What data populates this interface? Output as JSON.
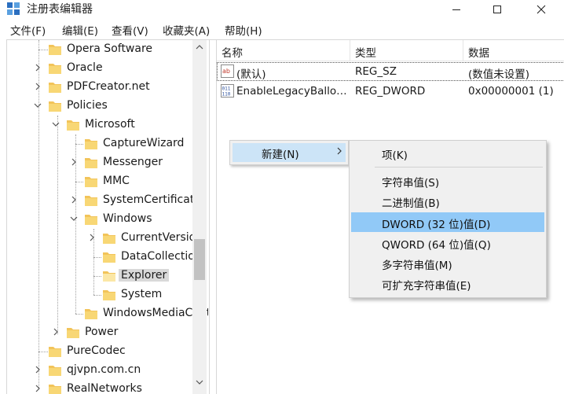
{
  "window": {
    "title": "注册表编辑器",
    "controls": {
      "minimize": "minimize-icon",
      "maximize": "maximize-icon",
      "close": "close-icon"
    }
  },
  "menubar": [
    {
      "label": "文件(F)"
    },
    {
      "label": "编辑(E)"
    },
    {
      "label": "查看(V)"
    },
    {
      "label": "收藏夹(A)"
    },
    {
      "label": "帮助(H)"
    }
  ],
  "tree": {
    "items": [
      {
        "label": "Opera Software",
        "expander": "none"
      },
      {
        "label": "Oracle",
        "expander": "collapsed"
      },
      {
        "label": "PDFCreator.net",
        "expander": "collapsed"
      },
      {
        "label": "Policies",
        "expander": "expanded"
      },
      {
        "label": "Microsoft",
        "expander": "expanded"
      },
      {
        "label": "CaptureWizard",
        "expander": "none"
      },
      {
        "label": "Messenger",
        "expander": "collapsed"
      },
      {
        "label": "MMC",
        "expander": "none"
      },
      {
        "label": "SystemCertificates",
        "expander": "collapsed"
      },
      {
        "label": "Windows",
        "expander": "expanded"
      },
      {
        "label": "CurrentVersion",
        "expander": "collapsed"
      },
      {
        "label": "DataCollection",
        "expander": "none"
      },
      {
        "label": "Explorer",
        "expander": "none",
        "selected": true
      },
      {
        "label": "System",
        "expander": "none"
      },
      {
        "label": "WindowsMediaCenter",
        "expander": "none"
      },
      {
        "label": "Power",
        "expander": "collapsed"
      },
      {
        "label": "PureCodec",
        "expander": "none"
      },
      {
        "label": "qjvpn.com.cn",
        "expander": "collapsed"
      },
      {
        "label": "RealNetworks",
        "expander": "collapsed"
      }
    ]
  },
  "list": {
    "columns": [
      "名称",
      "类型",
      "数据"
    ],
    "rows": [
      {
        "icon": "string-value-icon",
        "name": "(默认)",
        "type": "REG_SZ",
        "data": "(数值未设置)"
      },
      {
        "icon": "binary-value-icon",
        "name": "EnableLegacyBalloonNotifications",
        "type": "REG_DWORD",
        "data": "0x00000001 (1)"
      }
    ]
  },
  "context_menu": {
    "new_label": "新建(N)",
    "submenu": [
      {
        "label": "项(K)"
      },
      {
        "label": "字符串值(S)"
      },
      {
        "label": "二进制值(B)"
      },
      {
        "label": "DWORD (32 位)值(D)",
        "highlighted": true
      },
      {
        "label": "QWORD (64 位)值(Q)"
      },
      {
        "label": "多字符串值(M)"
      },
      {
        "label": "可扩充字符串值(E)"
      }
    ]
  },
  "colors": {
    "folder": "#f2c45a",
    "selection": "#d9d9d9",
    "menu_highlight": "#91c9f7",
    "menu_hover_parent": "#cce4f7"
  }
}
